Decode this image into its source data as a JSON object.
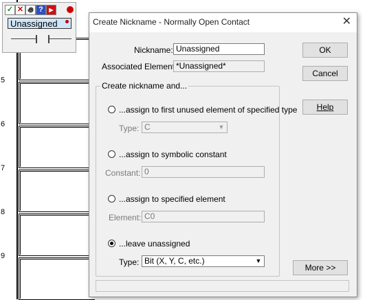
{
  "ladder": {
    "rung_numbers": [
      "5",
      "6",
      "7",
      "8",
      "9"
    ]
  },
  "palette": {
    "buttons": [
      "check-icon",
      "x-icon",
      "nickname-icon",
      "help-icon",
      "play-icon"
    ],
    "name": "Unassigned"
  },
  "dialog": {
    "title": "Create Nickname - Normally Open Contact",
    "nickname_label": "Nickname:",
    "nickname_value": "Unassigned",
    "assoc_label": "Associated Element:",
    "assoc_value": "*Unassigned*",
    "group_caption": "Create nickname and...",
    "options": [
      {
        "label": "...assign to first unused element of specified type",
        "sub_label": "Type:",
        "sub_value": "C",
        "selected": false
      },
      {
        "label": "...assign to symbolic constant",
        "sub_label": "Constant:",
        "sub_value": "0",
        "selected": false
      },
      {
        "label": "...assign to specified element",
        "sub_label": "Element:",
        "sub_value": "C0",
        "selected": false
      },
      {
        "label": "...leave unassigned",
        "sub_label": "Type:",
        "sub_value": "Bit (X, Y, C, etc.)",
        "selected": true
      }
    ],
    "buttons": {
      "ok": "OK",
      "cancel": "Cancel",
      "help": "Help",
      "more": "More >>"
    }
  }
}
